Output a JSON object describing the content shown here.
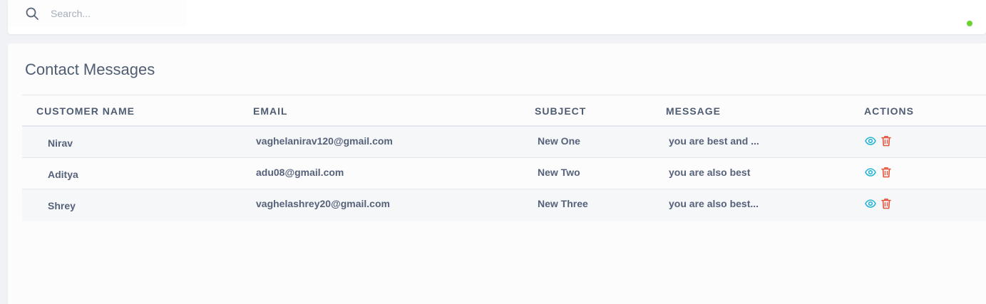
{
  "search": {
    "placeholder": "Search..."
  },
  "colors": {
    "status_dot": "#6ad12f",
    "view_icon": "#27b4d6",
    "delete_icon": "#e5533d",
    "text": "#4f5d73"
  },
  "page": {
    "title": "Contact Messages"
  },
  "table": {
    "headers": {
      "customer_name": "CUSTOMER NAME",
      "email": "EMAIL",
      "subject": "SUBJECT",
      "message": "MESSAGE",
      "actions": "ACTIONS"
    },
    "rows": [
      {
        "customer_name": "Nirav",
        "email": "vaghelanirav120@gmail.com",
        "subject": "New One",
        "message": "you are best and ..."
      },
      {
        "customer_name": "Aditya",
        "email": "adu08@gmail.com",
        "subject": "New Two",
        "message": "you are also best"
      },
      {
        "customer_name": "Shrey",
        "email": "vaghelashrey20@gmail.com",
        "subject": "New Three",
        "message": "you are also best..."
      }
    ],
    "row_actions": [
      "eye-icon",
      "trash-icon"
    ]
  }
}
